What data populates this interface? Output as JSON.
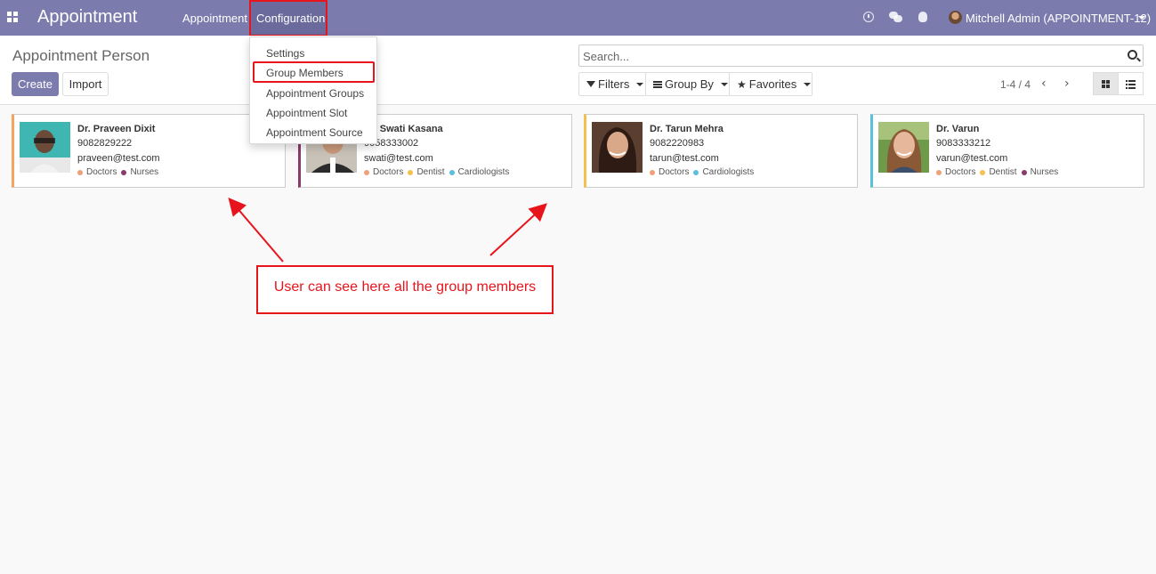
{
  "navbar": {
    "app_title": "Appointment",
    "menu_appointment": "Appointment",
    "menu_configuration": "Configuration",
    "user_label": "Mitchell Admin (APPOINTMENT-12)"
  },
  "control_panel": {
    "breadcrumb": "Appointment Person",
    "create_label": "Create",
    "import_label": "Import",
    "search_placeholder": "Search...",
    "filters_label": "Filters",
    "groupby_label": "Group By",
    "favorites_label": "Favorites",
    "pager_text": "1-4 / 4"
  },
  "dropdown": {
    "items": [
      "Settings",
      "Group Members",
      "Appointment Groups",
      "Appointment Slot",
      "Appointment Source"
    ]
  },
  "cards": [
    {
      "name": "Dr. Praveen Dixit",
      "phone": "9082829222",
      "email": "praveen@test.com",
      "color": "#f4a460",
      "tags": [
        {
          "label": "Doctors",
          "color": "#f0a078"
        },
        {
          "label": "Nurses",
          "color": "#8a3a6b"
        }
      ]
    },
    {
      "name": "Dr. Swati Kasana",
      "phone": "9058333002",
      "email": "swati@test.com",
      "color": "#8a3a6b",
      "tags": [
        {
          "label": "Doctors",
          "color": "#f0a078"
        },
        {
          "label": "Dentist",
          "color": "#f4c14e"
        },
        {
          "label": "Cardiologists",
          "color": "#5bc0de"
        }
      ]
    },
    {
      "name": "Dr. Tarun Mehra",
      "phone": "9082220983",
      "email": "tarun@test.com",
      "color": "#f4c14e",
      "tags": [
        {
          "label": "Doctors",
          "color": "#f0a078"
        },
        {
          "label": "Cardiologists",
          "color": "#5bc0de"
        }
      ]
    },
    {
      "name": "Dr. Varun",
      "phone": "9083333212",
      "email": "varun@test.com",
      "color": "#5bc0de",
      "tags": [
        {
          "label": "Doctors",
          "color": "#f0a078"
        },
        {
          "label": "Dentist",
          "color": "#f4c14e"
        },
        {
          "label": "Nurses",
          "color": "#8a3a6b"
        }
      ]
    }
  ],
  "annotation": {
    "text": "User can see here all the group members",
    "color": "#e8141c"
  }
}
